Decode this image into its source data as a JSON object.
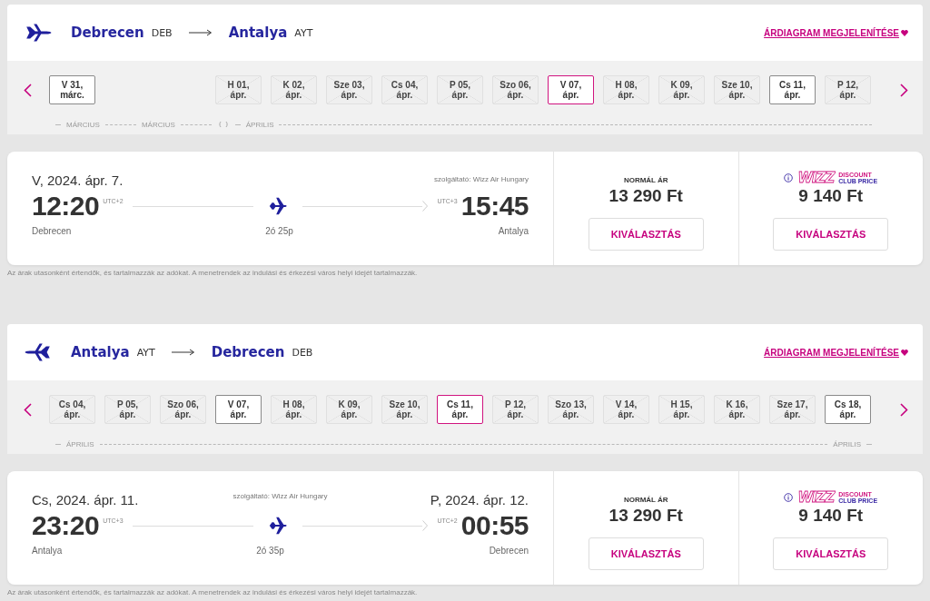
{
  "sections": [
    {
      "route": {
        "reversed": false,
        "from_city": "Debrecen",
        "from_code": "DEB",
        "to_city": "Antalya",
        "to_code": "AYT"
      },
      "chart_link": "ÁRDIAGRAM MEGJELENÍTÉSE",
      "dates": [
        {
          "kind": "tile",
          "day": "V 31,",
          "month": "márc.",
          "available": true,
          "selected": false
        },
        {
          "kind": "gap"
        },
        {
          "kind": "gap"
        },
        {
          "kind": "tile",
          "day": "H 01,",
          "month": "ápr.",
          "available": false,
          "selected": false
        },
        {
          "kind": "tile",
          "day": "K 02,",
          "month": "ápr.",
          "available": false,
          "selected": false
        },
        {
          "kind": "tile",
          "day": "Sze 03,",
          "month": "ápr.",
          "available": false,
          "selected": false
        },
        {
          "kind": "tile",
          "day": "Cs 04,",
          "month": "ápr.",
          "available": false,
          "selected": false
        },
        {
          "kind": "tile",
          "day": "P 05,",
          "month": "ápr.",
          "available": false,
          "selected": false
        },
        {
          "kind": "tile",
          "day": "Szo 06,",
          "month": "ápr.",
          "available": false,
          "selected": false
        },
        {
          "kind": "tile",
          "day": "V 07,",
          "month": "ápr.",
          "available": true,
          "selected": true
        },
        {
          "kind": "tile",
          "day": "H 08,",
          "month": "ápr.",
          "available": false,
          "selected": false
        },
        {
          "kind": "tile",
          "day": "K 09,",
          "month": "ápr.",
          "available": false,
          "selected": false
        },
        {
          "kind": "tile",
          "day": "Sze 10,",
          "month": "ápr.",
          "available": false,
          "selected": false
        },
        {
          "kind": "tile",
          "day": "Cs 11,",
          "month": "ápr.",
          "available": true,
          "selected": false
        },
        {
          "kind": "tile",
          "day": "P 12,",
          "month": "ápr.",
          "available": false,
          "selected": false
        }
      ],
      "timeline": [
        {
          "kind": "dash"
        },
        {
          "kind": "label",
          "text": "MÁRCIUS"
        },
        {
          "kind": "dash"
        },
        {
          "kind": "label",
          "text": "MÁRCIUS"
        },
        {
          "kind": "dash"
        },
        {
          "kind": "break"
        },
        {
          "kind": "dash"
        },
        {
          "kind": "label",
          "text": "ÁPRILIS"
        },
        {
          "kind": "line"
        }
      ],
      "flight": {
        "departure_date": "V, 2024. ápr. 7.",
        "operator": "szolgáltató: Wizz Air Hungary",
        "departure_time": "12:20",
        "departure_utc": "UTC+2",
        "arrival_utc": "UTC+3",
        "arrival_time": "15:45",
        "duration": "2ó 25p",
        "from_city": "Debrecen",
        "to_city": "Antalya"
      },
      "fares": [
        {
          "kind": "standard",
          "label": "NORMÁL ÁR",
          "price": "13 290 Ft",
          "button": "KIVÁLASZTÁS"
        },
        {
          "kind": "club",
          "logo_word": "WIZZ",
          "logo_line1": "DISCOUNT",
          "logo_line2": "CLUB PRICE",
          "price": "9 140 Ft",
          "button": "KIVÁLASZTÁS"
        }
      ],
      "note": "Az árak utasonként értendők, és tartalmazzák az adókat. A menetrendek az indulási és érkezési város helyi idejét tartalmazzák."
    },
    {
      "route": {
        "reversed": true,
        "from_city": "Antalya",
        "from_code": "AYT",
        "to_city": "Debrecen",
        "to_code": "DEB"
      },
      "chart_link": "ÁRDIAGRAM MEGJELENÍTÉSE",
      "dates": [
        {
          "kind": "tile",
          "day": "Cs 04,",
          "month": "ápr.",
          "available": false,
          "selected": false
        },
        {
          "kind": "tile",
          "day": "P 05,",
          "month": "ápr.",
          "available": false,
          "selected": false
        },
        {
          "kind": "tile",
          "day": "Szo 06,",
          "month": "ápr.",
          "available": false,
          "selected": false
        },
        {
          "kind": "tile",
          "day": "V 07,",
          "month": "ápr.",
          "available": true,
          "selected": false
        },
        {
          "kind": "tile",
          "day": "H 08,",
          "month": "ápr.",
          "available": false,
          "selected": false
        },
        {
          "kind": "tile",
          "day": "K 09,",
          "month": "ápr.",
          "available": false,
          "selected": false
        },
        {
          "kind": "tile",
          "day": "Sze 10,",
          "month": "ápr.",
          "available": false,
          "selected": false
        },
        {
          "kind": "tile",
          "day": "Cs 11,",
          "month": "ápr.",
          "available": true,
          "selected": true
        },
        {
          "kind": "tile",
          "day": "P 12,",
          "month": "ápr.",
          "available": false,
          "selected": false
        },
        {
          "kind": "tile",
          "day": "Szo 13,",
          "month": "ápr.",
          "available": false,
          "selected": false
        },
        {
          "kind": "tile",
          "day": "V 14,",
          "month": "ápr.",
          "available": false,
          "selected": false
        },
        {
          "kind": "tile",
          "day": "H 15,",
          "month": "ápr.",
          "available": false,
          "selected": false
        },
        {
          "kind": "tile",
          "day": "K 16,",
          "month": "ápr.",
          "available": false,
          "selected": false
        },
        {
          "kind": "tile",
          "day": "Sze 17,",
          "month": "ápr.",
          "available": false,
          "selected": false
        },
        {
          "kind": "tile",
          "day": "Cs 18,",
          "month": "ápr.",
          "available": true,
          "selected": false
        }
      ],
      "timeline": [
        {
          "kind": "dash"
        },
        {
          "kind": "label",
          "text": "ÁPRILIS"
        },
        {
          "kind": "line"
        },
        {
          "kind": "label",
          "text": "ÁPRILIS"
        },
        {
          "kind": "dash"
        }
      ],
      "flight": {
        "departure_date": "Cs, 2024. ápr. 11.",
        "operator": "szolgáltató: Wizz Air Hungary",
        "arrival_date": "P, 2024. ápr. 12.",
        "departure_time": "23:20",
        "departure_utc": "UTC+3",
        "arrival_utc": "UTC+2",
        "arrival_time": "00:55",
        "duration": "2ó 35p",
        "from_city": "Antalya",
        "to_city": "Debrecen"
      },
      "fares": [
        {
          "kind": "standard",
          "label": "NORMÁL ÁR",
          "price": "13 290 Ft",
          "button": "KIVÁLASZTÁS"
        },
        {
          "kind": "club",
          "logo_word": "WIZZ",
          "logo_line1": "DISCOUNT",
          "logo_line2": "CLUB PRICE",
          "price": "9 140 Ft",
          "button": "KIVÁLASZTÁS"
        }
      ],
      "note": "Az árak utasonként értendők, és tartalmazzák az adókat. A menetrendek az indulási és érkezési város helyi idejét tartalmazzák."
    }
  ]
}
